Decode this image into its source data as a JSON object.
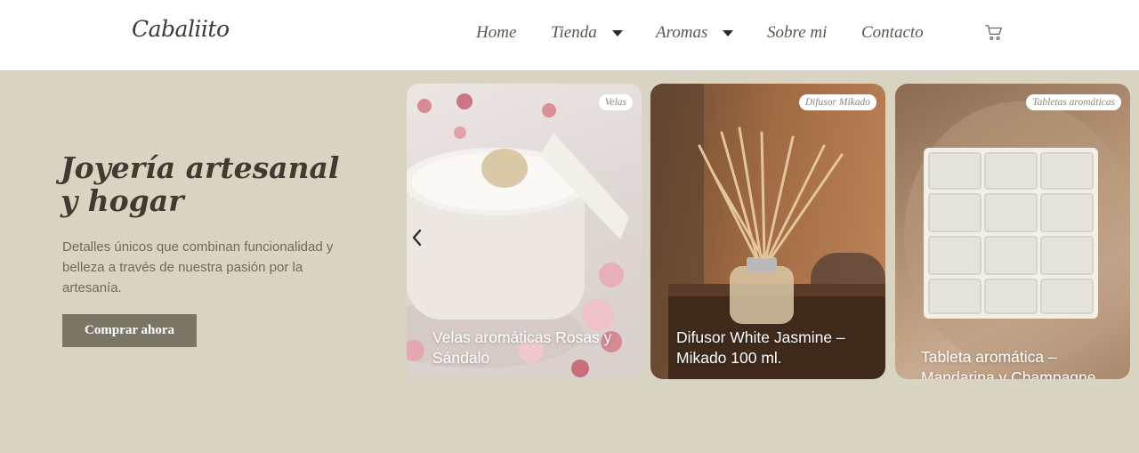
{
  "header": {
    "logo": "Cabaliito",
    "nav": {
      "home": "Home",
      "tienda": "Tienda",
      "aromas": "Aromas",
      "sobre": "Sobre mi",
      "contacto": "Contacto"
    },
    "cart_icon": "shopping-cart-icon"
  },
  "hero": {
    "title": "Joyería artesanal y hogar",
    "description": "Detalles únicos que combinan funcionalidad y belleza a través de nuestra pasión por la artesanía.",
    "cta_label": "Comprar ahora"
  },
  "carousel": {
    "prev_icon": "chevron-left-icon",
    "cards": [
      {
        "badge": "Velas",
        "title": "Velas aromáticas Rosas y Sándalo"
      },
      {
        "badge": "Difusor Mikado",
        "title": "Difusor White Jasmine – Mikado 100 ml."
      },
      {
        "badge": "Tabletas aromáticas",
        "title": "Tableta aromática – Mandarina y Champagne"
      }
    ]
  },
  "colors": {
    "background": "#d9d3c1",
    "header": "#ffffff",
    "button": "#7b7565",
    "heading": "#3f3b30"
  }
}
